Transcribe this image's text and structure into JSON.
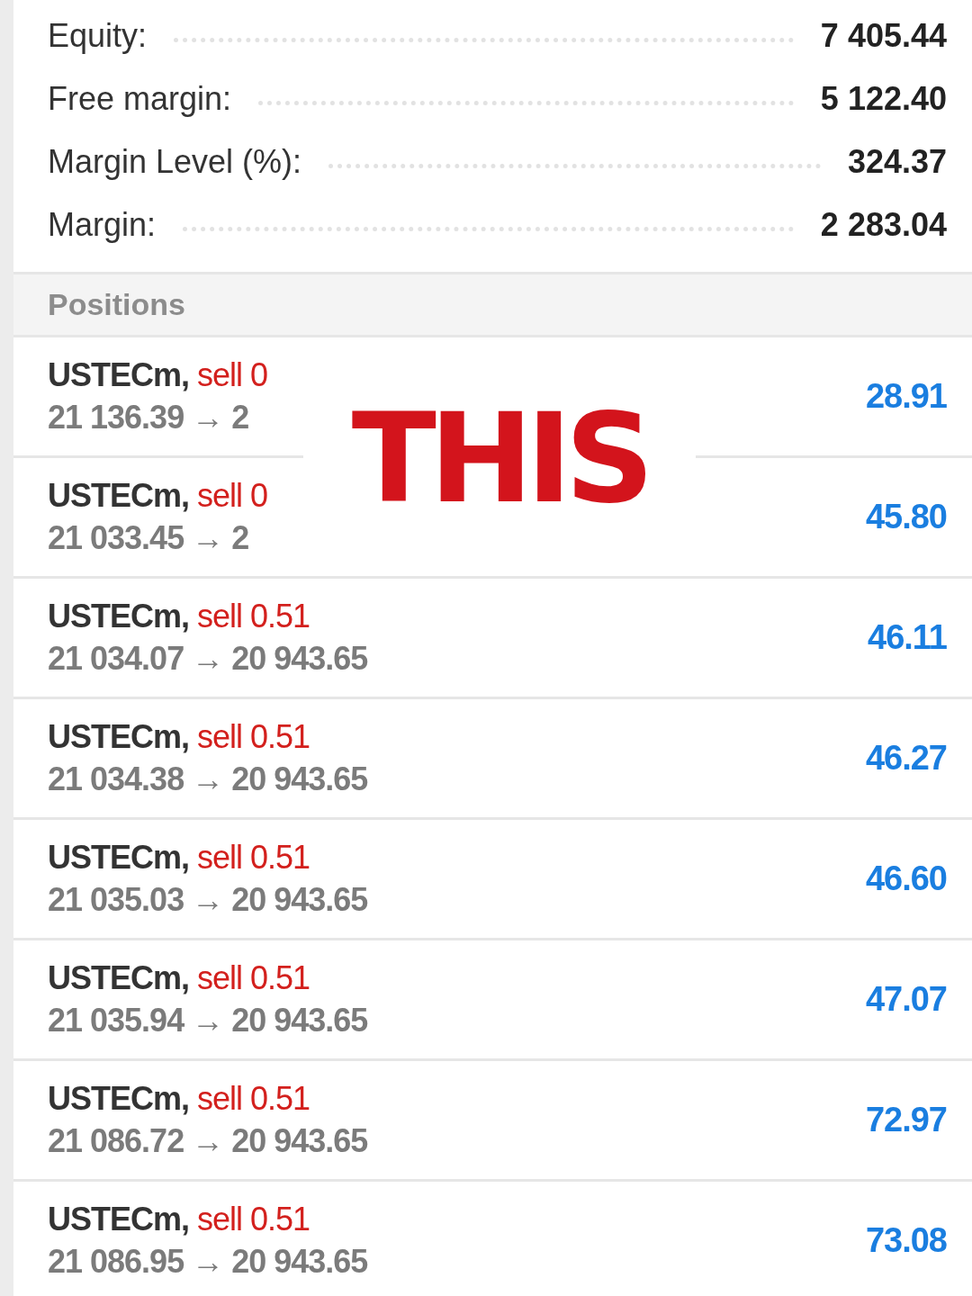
{
  "summary": [
    {
      "label": "Equity:",
      "value": "7 405.44"
    },
    {
      "label": "Free margin:",
      "value": "5 122.40"
    },
    {
      "label": "Margin Level (%):",
      "value": "324.37"
    },
    {
      "label": "Margin:",
      "value": "2 283.04"
    }
  ],
  "positions_header": "Positions",
  "positions": [
    {
      "symbol": "USTECm,",
      "order": "sell 0",
      "prices": "21 136.39 → 2",
      "profit": "28.91"
    },
    {
      "symbol": "USTECm,",
      "order": "sell 0",
      "prices": "21 033.45 → 2",
      "profit": "45.80"
    },
    {
      "symbol": "USTECm,",
      "order": "sell 0.51",
      "prices": "21 034.07 → 20 943.65",
      "profit": "46.11"
    },
    {
      "symbol": "USTECm,",
      "order": "sell 0.51",
      "prices": "21 034.38 → 20 943.65",
      "profit": "46.27"
    },
    {
      "symbol": "USTECm,",
      "order": "sell 0.51",
      "prices": "21 035.03 → 20 943.65",
      "profit": "46.60"
    },
    {
      "symbol": "USTECm,",
      "order": "sell 0.51",
      "prices": "21 035.94 → 20 943.65",
      "profit": "47.07"
    },
    {
      "symbol": "USTECm,",
      "order": "sell 0.51",
      "prices": "21 086.72 → 20 943.65",
      "profit": "72.97"
    },
    {
      "symbol": "USTECm,",
      "order": "sell 0.51",
      "prices": "21 086.95 → 20 943.65",
      "profit": "73.08"
    }
  ],
  "overlay_caption": "THIS"
}
